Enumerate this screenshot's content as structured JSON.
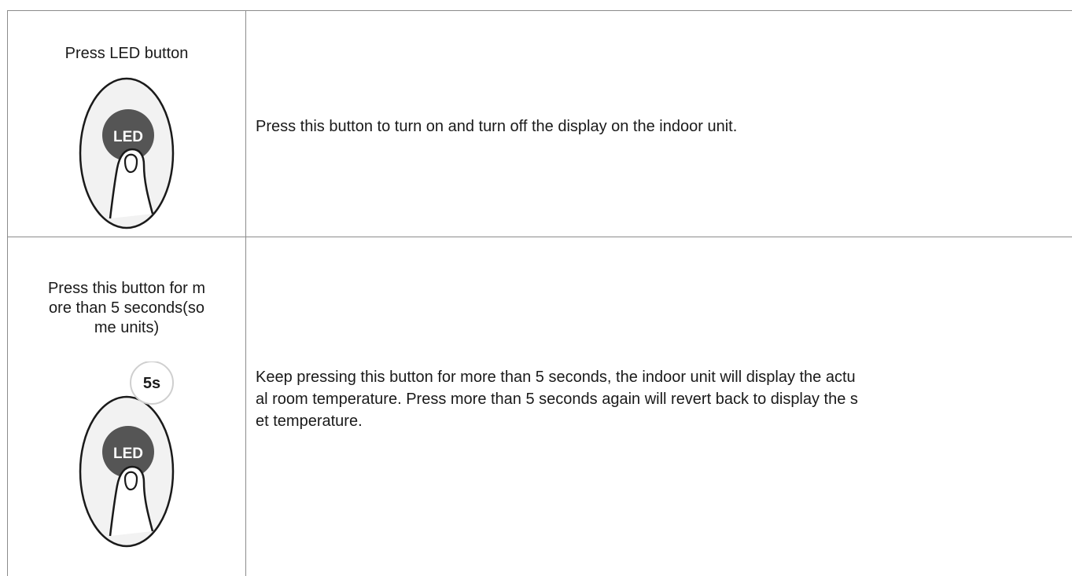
{
  "rows": [
    {
      "label_lines": [
        "Press LED button"
      ],
      "button_text": "LED",
      "badge_text": "",
      "description_lines": [
        "Press this button to turn on and turn off the display on the indoor unit."
      ]
    },
    {
      "label_lines": [
        "Press this button for m",
        "ore than 5 seconds(so",
        "me units)"
      ],
      "button_text": "LED",
      "badge_text": "5s",
      "description_lines": [
        "Keep pressing this button for more than 5 seconds, the indoor unit will display the actu",
        "al room temperature. Press more than 5 seconds again will revert back to display the s",
        "et temperature."
      ]
    }
  ]
}
